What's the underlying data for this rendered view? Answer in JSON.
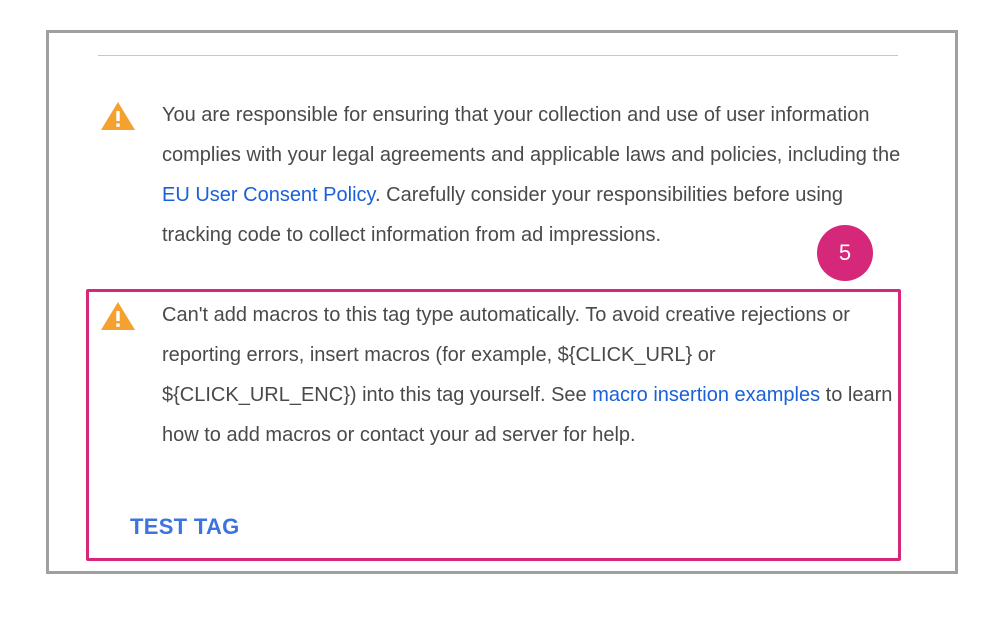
{
  "colors": {
    "warning": "#f5a130",
    "link": "#1a60d8",
    "highlight": "#d6287a",
    "border": "#a0a0a0",
    "text": "#4a4a4a"
  },
  "notice_1": {
    "icon": "warning-triangle-icon",
    "text_before": "You are responsible for ensuring that your collection and use of user information complies with your legal agreements and applicable laws and policies, including the ",
    "link": "EU User Consent Policy",
    "text_after": ". Carefully consider your responsibilities before using tracking code to collect information from ad impressions."
  },
  "notice_2": {
    "icon": "warning-triangle-icon",
    "text_before": "Can't add macros to this tag type automatically. To avoid creative rejections or reporting errors, insert macros (for example, ${CLICK_URL} or ${CLICK_URL_ENC}) into this tag yourself. See ",
    "link": "macro insertion examples",
    "text_after": " to learn how to add macros or contact your ad server for help."
  },
  "test_tag_label": "TEST TAG",
  "step_badge": "5"
}
